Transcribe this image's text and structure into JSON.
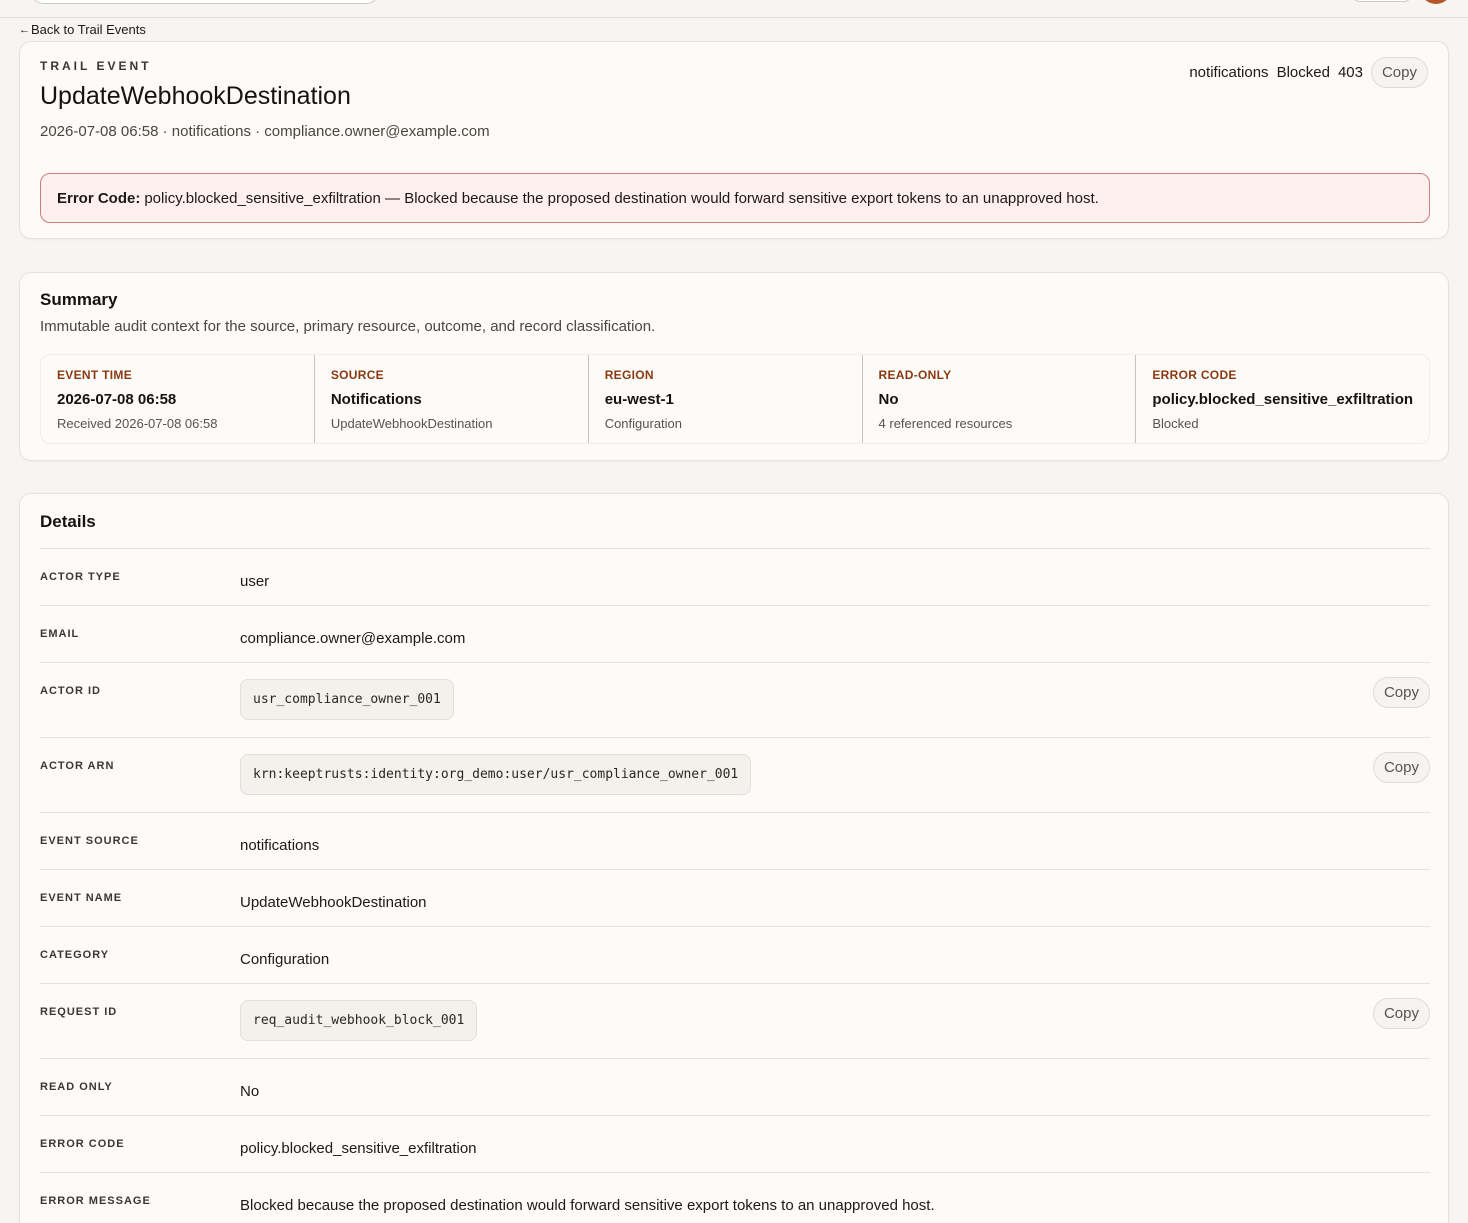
{
  "nav": {
    "back_label": "Back to Trail Events",
    "back_arrow": "←"
  },
  "header": {
    "eyebrow": "TRAIL EVENT",
    "title": "UpdateWebhookDestination",
    "meta": "2026-07-08 06:58 · notifications · compliance.owner@example.com",
    "tag_source": "notifications",
    "tag_outcome": "Blocked",
    "tag_status": "403",
    "copy_label": "Copy"
  },
  "error_banner": {
    "label": "Error Code:",
    "text": "policy.blocked_sensitive_exfiltration — Blocked because the proposed destination would forward sensitive export tokens to an unapproved host."
  },
  "summary": {
    "title": "Summary",
    "description": "Immutable audit context for the source, primary resource, outcome, and record classification.",
    "stats": [
      {
        "label": "EVENT TIME",
        "value": "2026-07-08 06:58",
        "sub": "Received 2026-07-08 06:58"
      },
      {
        "label": "SOURCE",
        "value": "Notifications",
        "sub": "UpdateWebhookDestination"
      },
      {
        "label": "REGION",
        "value": "eu-west-1",
        "sub": "Configuration"
      },
      {
        "label": "READ-ONLY",
        "value": "No",
        "sub": "4 referenced resources"
      },
      {
        "label": "ERROR CODE",
        "value": "policy.blocked_sensitive_exfiltration",
        "sub": "Blocked"
      }
    ]
  },
  "details": {
    "title": "Details",
    "copy_label": "Copy",
    "rows": [
      {
        "label": "ACTOR TYPE",
        "value": "user"
      },
      {
        "label": "EMAIL",
        "value": "compliance.owner@example.com"
      },
      {
        "label": "ACTOR ID",
        "value": "usr_compliance_owner_001"
      },
      {
        "label": "ACTOR ARN",
        "value": "krn:keeptrusts:identity:org_demo:user/usr_compliance_owner_001"
      },
      {
        "label": "EVENT SOURCE",
        "value": "notifications"
      },
      {
        "label": "EVENT NAME",
        "value": "UpdateWebhookDestination"
      },
      {
        "label": "CATEGORY",
        "value": "Configuration"
      },
      {
        "label": "REQUEST ID",
        "value": "req_audit_webhook_block_001"
      },
      {
        "label": "READ ONLY",
        "value": "No"
      },
      {
        "label": "ERROR CODE",
        "value": "policy.blocked_sensitive_exfiltration"
      },
      {
        "label": "ERROR MESSAGE",
        "value": "Blocked because the proposed destination would forward sensitive export tokens to an unapproved host."
      }
    ]
  },
  "colors": {
    "accent_label": "#8a3a12",
    "error_border": "#cf7c7c",
    "error_bg": "#fdf0ef",
    "avatar": "#b4562a"
  }
}
